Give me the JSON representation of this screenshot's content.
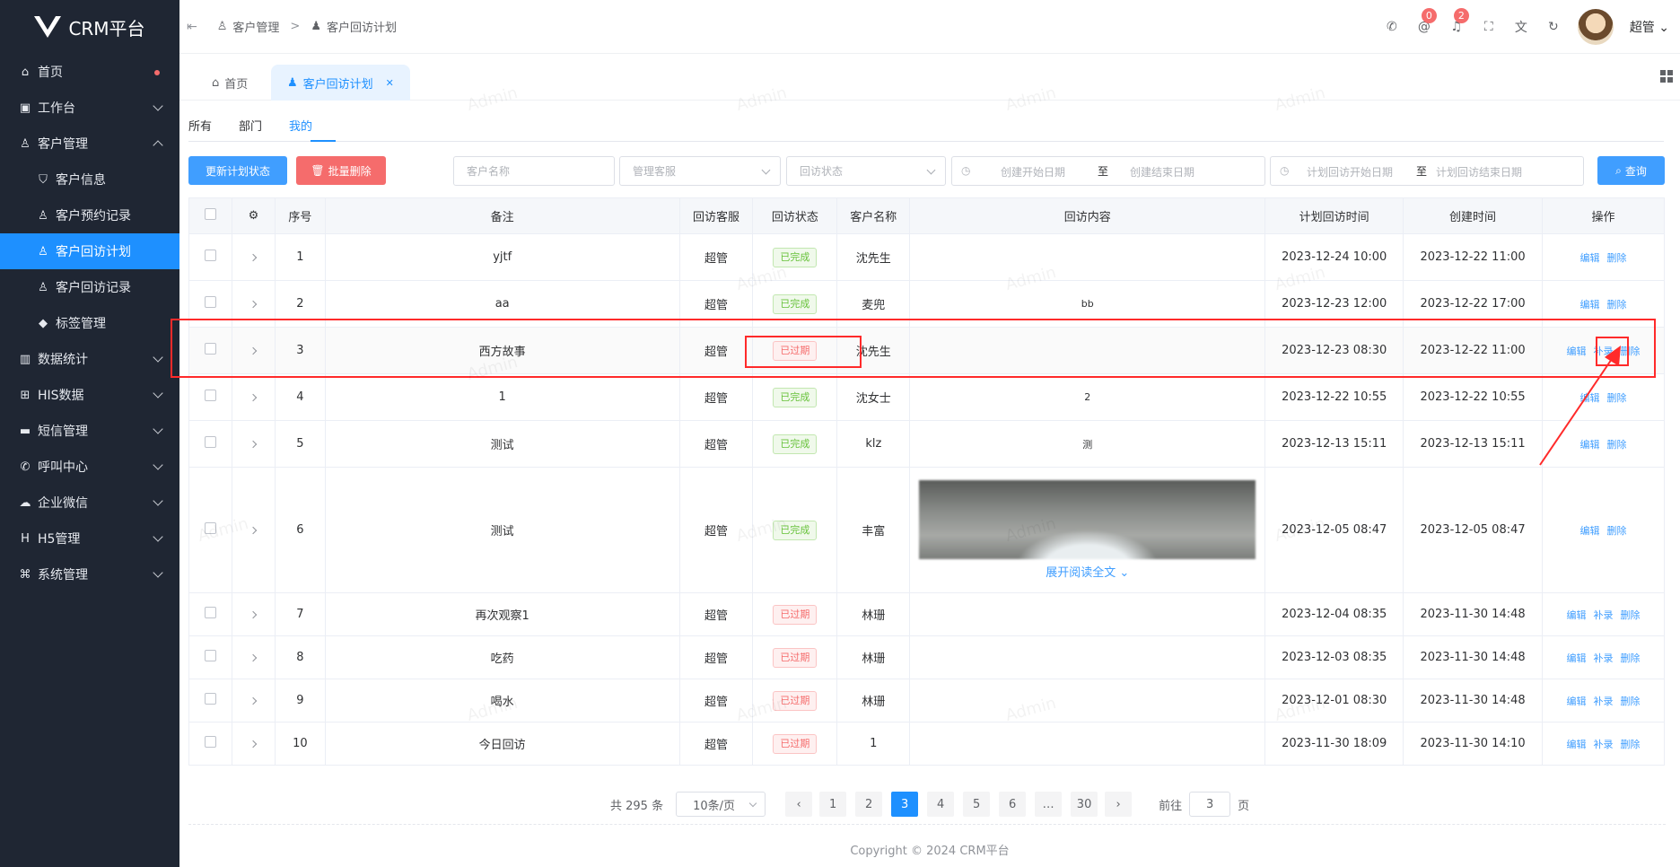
{
  "app": {
    "title": "CRM平台"
  },
  "sidebar": {
    "items": [
      {
        "label": "首页",
        "icon": "home-icon",
        "dot": true
      },
      {
        "label": "工作台",
        "icon": "briefcase-icon",
        "chevron": "down"
      },
      {
        "label": "客户管理",
        "icon": "user-icon",
        "chevron": "up"
      },
      {
        "label": "客户信息",
        "icon": "shield-user-icon",
        "sub": true
      },
      {
        "label": "客户预约记录",
        "icon": "user-icon",
        "sub": true
      },
      {
        "label": "客户回访计划",
        "icon": "user-icon",
        "sub": true,
        "active": true
      },
      {
        "label": "客户回访记录",
        "icon": "user-icon",
        "sub": true
      },
      {
        "label": "标签管理",
        "icon": "badge-icon",
        "sub": true
      },
      {
        "label": "数据统计",
        "icon": "bar-chart-icon",
        "chevron": "down"
      },
      {
        "label": "HIS数据",
        "icon": "hospital-icon",
        "chevron": "down"
      },
      {
        "label": "短信管理",
        "icon": "message-icon",
        "chevron": "down"
      },
      {
        "label": "呼叫中心",
        "icon": "phone-icon",
        "chevron": "down"
      },
      {
        "label": "企业微信",
        "icon": "wechat-icon",
        "chevron": "down"
      },
      {
        "label": "H5管理",
        "icon": "h5-icon",
        "chevron": "down"
      },
      {
        "label": "系统管理",
        "icon": "command-icon",
        "chevron": "down"
      }
    ]
  },
  "header": {
    "breadcrumb": [
      "客户管理",
      "客户回访计划"
    ],
    "badges": {
      "mentions": "0",
      "notifications": "2"
    },
    "user": "超管"
  },
  "tabs": [
    {
      "label": "首页"
    },
    {
      "label": "客户回访计划"
    }
  ],
  "subtabs": [
    "所有",
    "部门",
    "我的"
  ],
  "toolbar": {
    "update_status": "更新计划状态",
    "batch_delete": "批量删除",
    "customer_name_ph": "客户名称",
    "manager_ph": "管理客服",
    "status_ph": "回访状态",
    "create_start_ph": "创建开始日期",
    "create_end_ph": "创建结束日期",
    "plan_start_ph": "计划回访开始日期",
    "plan_end_ph": "计划回访结束日期",
    "to": "至",
    "search": "查询"
  },
  "table": {
    "headers": [
      "序号",
      "备注",
      "回访客服",
      "回访状态",
      "客户名称",
      "回访内容",
      "计划回访时间",
      "创建时间",
      "操作"
    ],
    "rows": [
      {
        "no": "1",
        "remark": "yjtf",
        "agent": "超管",
        "status": "已完成",
        "ok": true,
        "customer": "沈先生",
        "content": "",
        "plan": "2023-12-24 10:00",
        "created": "2023-12-22 11:00",
        "ops": [
          "编辑",
          "删除"
        ]
      },
      {
        "no": "2",
        "remark": "aa",
        "agent": "超管",
        "status": "已完成",
        "ok": true,
        "customer": "麦兜",
        "content": "bb",
        "plan": "2023-12-23 12:00",
        "created": "2023-12-22 17:00",
        "ops": [
          "编辑",
          "删除"
        ]
      },
      {
        "no": "3",
        "remark": "西方故事",
        "agent": "超管",
        "status": "已过期",
        "ok": false,
        "customer": "沈先生",
        "content": "",
        "plan": "2023-12-23 08:30",
        "created": "2023-12-22 11:00",
        "ops": [
          "编辑",
          "补录",
          "删除"
        ]
      },
      {
        "no": "4",
        "remark": "1",
        "agent": "超管",
        "status": "已完成",
        "ok": true,
        "customer": "沈女士",
        "content": "2",
        "plan": "2023-12-22 10:55",
        "created": "2023-12-22 10:55",
        "ops": [
          "编辑",
          "删除"
        ]
      },
      {
        "no": "5",
        "remark": "测试",
        "agent": "超管",
        "status": "已完成",
        "ok": true,
        "customer": "klz",
        "content": "测",
        "plan": "2023-12-13 15:11",
        "created": "2023-12-13 15:11",
        "ops": [
          "编辑",
          "删除"
        ]
      },
      {
        "no": "6",
        "remark": "测试",
        "agent": "超管",
        "status": "已完成",
        "ok": true,
        "customer": "丰富",
        "content": "",
        "image": true,
        "more": "展开阅读全文",
        "plan": "2023-12-05 08:47",
        "created": "2023-12-05 08:47",
        "ops": [
          "编辑",
          "删除"
        ]
      },
      {
        "no": "7",
        "remark": "再次观察1",
        "agent": "超管",
        "status": "已过期",
        "ok": false,
        "customer": "林珊",
        "content": "",
        "plan": "2023-12-04 08:35",
        "created": "2023-11-30 14:48",
        "ops": [
          "编辑",
          "补录",
          "删除"
        ]
      },
      {
        "no": "8",
        "remark": "吃药",
        "agent": "超管",
        "status": "已过期",
        "ok": false,
        "customer": "林珊",
        "content": "",
        "plan": "2023-12-03 08:35",
        "created": "2023-11-30 14:48",
        "ops": [
          "编辑",
          "补录",
          "删除"
        ]
      },
      {
        "no": "9",
        "remark": "喝水",
        "agent": "超管",
        "status": "已过期",
        "ok": false,
        "customer": "林珊",
        "content": "",
        "plan": "2023-12-01 08:30",
        "created": "2023-11-30 14:48",
        "ops": [
          "编辑",
          "补录",
          "删除"
        ]
      },
      {
        "no": "10",
        "remark": "今日回访",
        "agent": "超管",
        "status": "已过期",
        "ok": false,
        "customer": "1",
        "content": "",
        "plan": "2023-11-30 18:09",
        "created": "2023-11-30 14:10",
        "ops": [
          "编辑",
          "补录",
          "删除"
        ]
      }
    ]
  },
  "pagination": {
    "total": "共 295 条",
    "page_size": "10条/页",
    "pages": [
      "1",
      "2",
      "3",
      "4",
      "5",
      "6",
      "…",
      "30"
    ],
    "current": "3",
    "goto_label": "前往",
    "goto_value": "3",
    "page_unit": "页"
  },
  "footer": "Copyright © 2024 CRM平台",
  "watermark": "Admin",
  "colors": {
    "primary": "#1e90ff",
    "danger": "#f56c6c",
    "success": "#67c23a",
    "sidebar": "#1f2633",
    "annotation": "#ff2a2a"
  }
}
